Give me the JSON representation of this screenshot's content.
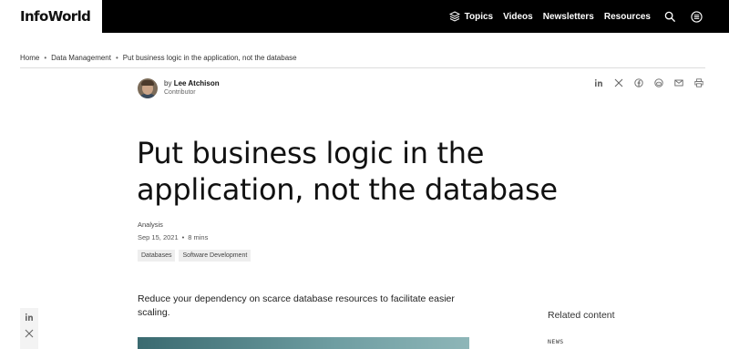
{
  "header": {
    "logo": "InfoWorld",
    "nav": [
      {
        "label": "Topics",
        "icon": "layers-icon"
      },
      {
        "label": "Videos"
      },
      {
        "label": "Newsletters"
      },
      {
        "label": "Resources"
      }
    ],
    "icons": [
      "search-icon",
      "menu-icon"
    ]
  },
  "breadcrumb": [
    "Home",
    "Data Management",
    "Put business logic in the application, not the database"
  ],
  "author": {
    "by": "by",
    "name": "Lee Atchison",
    "role": "Contributor"
  },
  "share_icons": [
    "linkedin-icon",
    "x-icon",
    "facebook-icon",
    "reddit-icon",
    "email-icon",
    "print-icon"
  ],
  "article": {
    "title": "Put business logic in the application, not the database",
    "type": "Analysis",
    "date": "Sep 15, 2021",
    "sep": "•",
    "read_time": "8 mins",
    "tags": [
      "Databases",
      "Software Development"
    ],
    "summary": "Reduce your dependency on scarce database resources to facilitate easier scaling."
  },
  "sidebar": {
    "related_title": "Related content",
    "related_tag": "NEWS"
  },
  "colors": {
    "header_bg": "#000000",
    "text": "#111111",
    "tag_bg": "#eeeeee"
  }
}
